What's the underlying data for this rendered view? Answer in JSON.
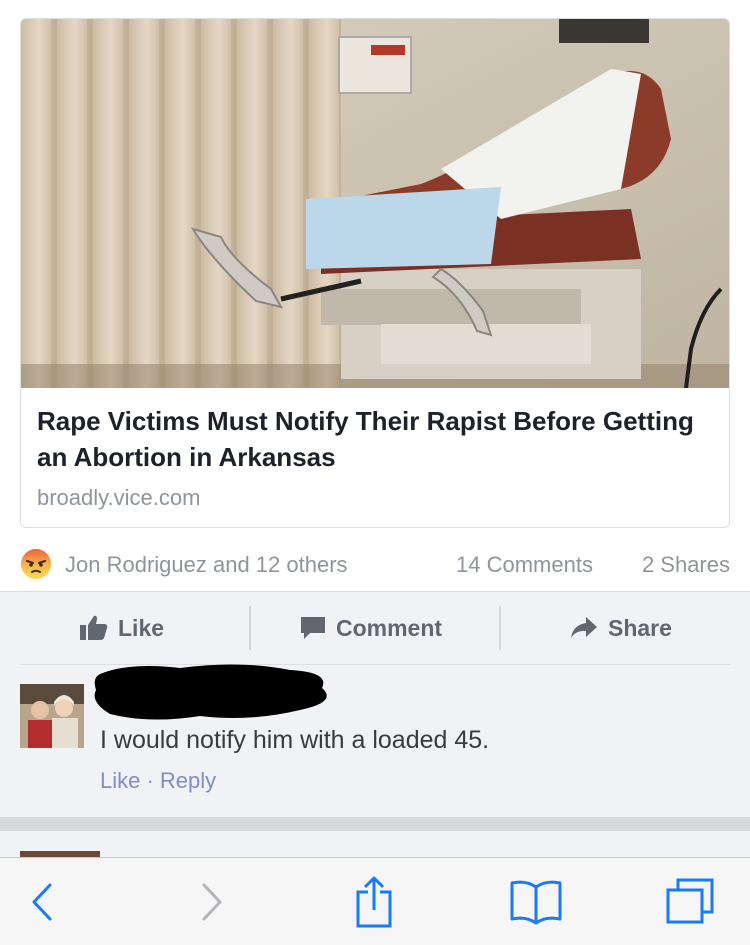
{
  "link_card": {
    "title": "Rape Victims Must Notify Their Rapist Before Getting an Abortion in Arkansas",
    "domain": "broadly.vice.com"
  },
  "reactions": {
    "reaction_icon": "angry-face-icon",
    "names": "Jon Rodriguez and 12 others",
    "comments": "14 Comments",
    "shares": "2 Shares"
  },
  "actions": {
    "like": "Like",
    "comment": "Comment",
    "share": "Share"
  },
  "comment": {
    "text": "I would notify him with a loaded 45.",
    "like": "Like",
    "separator": " · ",
    "reply": "Reply"
  },
  "colors": {
    "link_blue": "#7f8ec4",
    "action_gray": "#606770",
    "meta_gray": "#90949c",
    "ios_blue": "#1a7cf5"
  },
  "toolbar": {
    "icons": [
      "back-icon",
      "forward-icon",
      "share-icon",
      "bookmarks-icon",
      "tabs-icon"
    ]
  }
}
